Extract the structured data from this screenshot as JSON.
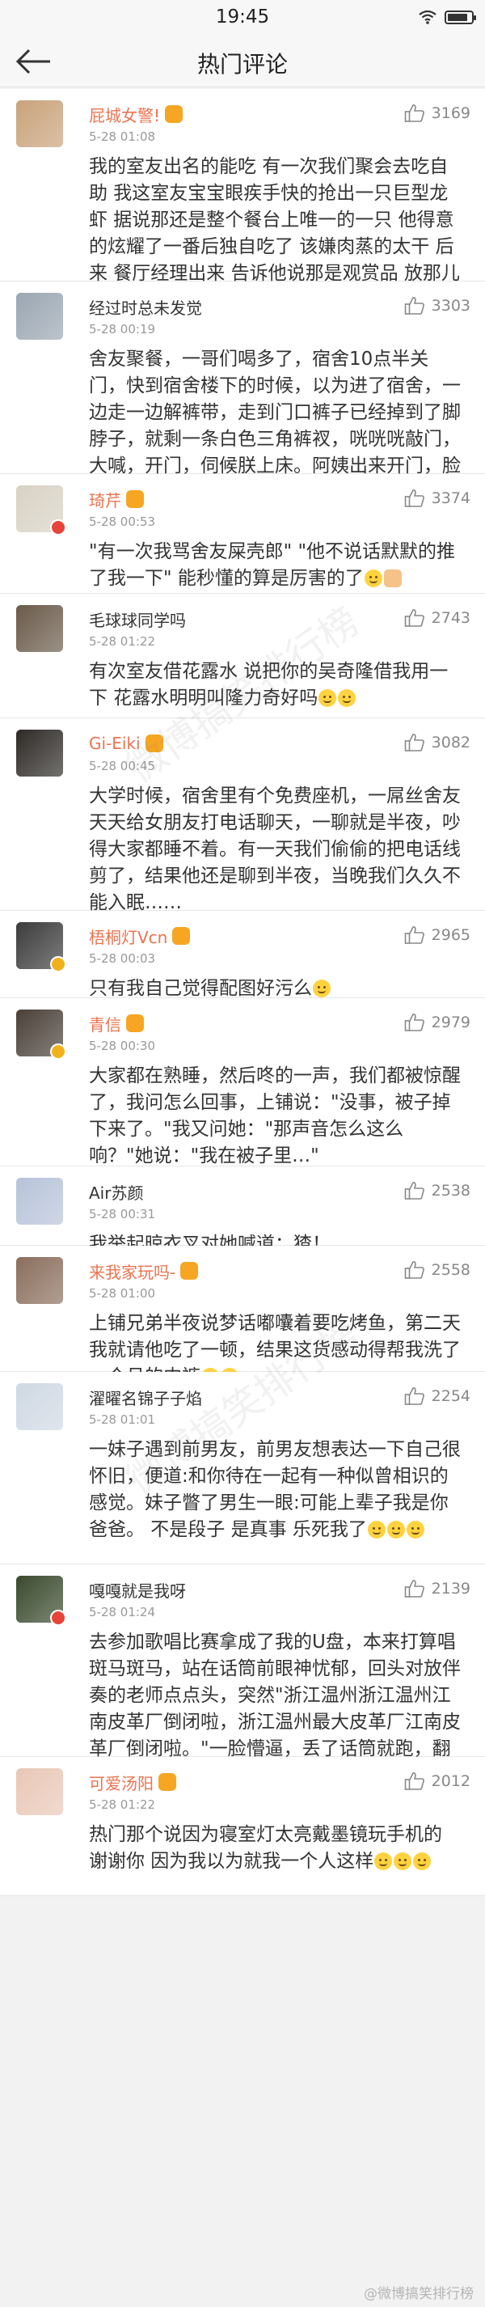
{
  "status_bar": {
    "time": "19:45",
    "battery_level": 0.85
  },
  "nav": {
    "title": "热门评论"
  },
  "comments": [
    {
      "user": "屁城女警!",
      "time": "5-28 01:08",
      "likes": "3169",
      "text": "我的室友出名的能吃 有一次我们聚会去吃自助 我这室友宝宝眼疾手快的抢出一只巨型龙虾 据说那还是整个餐台上唯一的一只 他得意的炫耀了一番后独自吃了 该嫌肉蒸的太干 后来 餐厅经理出来 告诉他说那是观赏品 放那儿好几年了……",
      "avatar_color": "#c9a27a"
    },
    {
      "user": "经过时总未发觉",
      "time": "5-28 00:19",
      "likes": "3303",
      "text": "舍友聚餐，一哥们喝多了，宿舍10点半关门，快到宿舍楼下的时候，以为进了宿舍，一边走一边解裤带，走到门口裤子已经掉到了脚脖子，就剩一条白色三角裤衩，咣咣咣敲门，大喊，开门，伺候朕上床。阿姨出来开门，脸都绿了",
      "avatar_color": "#9aa6b2"
    },
    {
      "user": "琦芹",
      "time": "5-28 00:53",
      "likes": "3374",
      "text": "\"有一次我骂舍友屎壳郎\" \"他不说话默默的推了我一下\"                能秒懂的算是厉害的了",
      "avatar_color": "#d8d2c4"
    },
    {
      "user": "毛球球同学吗",
      "time": "5-28 01:22",
      "likes": "2743",
      "text": "有次室友借花露水 说把你的吴奇隆借我用一下 花露水明明叫隆力奇好吗",
      "avatar_color": "#6a5a4a"
    },
    {
      "user": "Gi-Eiki",
      "time": "5-28 00:45",
      "likes": "3082",
      "text": "大学时候，宿舍里有个免费座机，一屌丝舍友天天给女朋友打电话聊天，一聊就是半夜，吵得大家都睡不着。有一天我们偷偷的把电话线剪了，结果他还是聊到半夜，当晚我们久久不能入眠……",
      "avatar_color": "#2d2a26"
    },
    {
      "user": "梧桐灯Vcn",
      "time": "5-28 00:03",
      "likes": "2965",
      "text": "只有我自己觉得配图好污么",
      "avatar_color": "#3c3c3c"
    },
    {
      "user": "青信",
      "time": "5-28 00:30",
      "likes": "2979",
      "text": "大家都在熟睡，然后咚的一声，我们都被惊醒了，我问怎么回事，上铺说：\"没事，被子掉下来了。\"我又问她：\"那声音怎么这么响？\"她说：\"我在被子里…\"",
      "avatar_color": "#4a4038"
    },
    {
      "user": "Air苏颜",
      "time": "5-28 00:31",
      "likes": "2538",
      "text": "我举起晾衣叉对她喊道：猹！",
      "avatar_color": "#b7c3d9"
    },
    {
      "user": "来我家玩吗-",
      "time": "5-28 01:00",
      "likes": "2558",
      "text": "上铺兄弟半夜说梦话嘟囔着要吃烤鱼，第二天我就请他吃了一顿，结果这货感动得帮我洗了一个月的内裤",
      "avatar_color": "#8a6e5c"
    },
    {
      "user": "濯曜名锦子子焰",
      "time": "5-28 01:01",
      "likes": "2254",
      "text": "一妹子遇到前男友，前男友想表达一下自己很怀旧，便道:和你待在一起有一种似曾相识的感觉。妹子瞥了男生一眼:可能上辈子我是你爸爸。 不是段子   是真事   乐死我了",
      "avatar_color": "#cfd8e3"
    },
    {
      "user": "嘎嘎就是我呀",
      "time": "5-28 01:24",
      "likes": "2139",
      "text": "去参加歌唱比赛拿成了我的U盘，本来打算唱斑马斑马，站在话筒前眼神忧郁，回头对放伴奏的老师点点头，突然\"浙江温州浙江温州江南皮革厂倒闭啦，浙江温州最大皮革厂江南皮革厂倒闭啦。\"一脸懵逼，丢了话筒就跑，翻船来不及说再见",
      "avatar_color": "#3a4a2e"
    },
    {
      "user": "可爱汤阳",
      "time": "5-28 01:22",
      "likes": "2012",
      "text": "热门那个说因为寝室灯太亮戴墨镜玩手机的 谢谢你 因为我以为就我一个人这样",
      "avatar_color": "#e9c7b6"
    }
  ],
  "watermark": {
    "text": "微博搞笑排行榜"
  },
  "footer": {
    "text": "@微博搞笑排行榜"
  }
}
